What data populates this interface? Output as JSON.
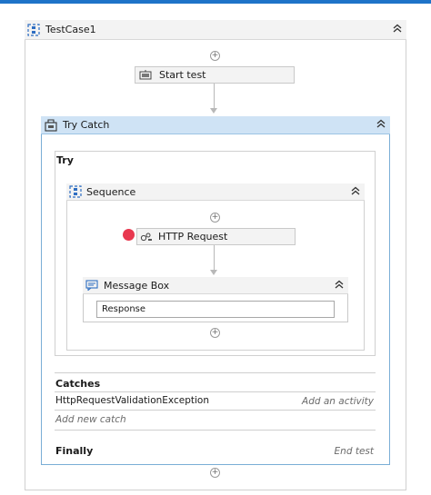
{
  "workflow": {
    "title": "TestCase1",
    "start_test": "Start test",
    "try_catch": {
      "title": "Try Catch",
      "try_label": "Try",
      "sequence": {
        "title": "Sequence",
        "http_request": "HTTP Request",
        "message_box": {
          "title": "Message Box",
          "input_value": "Response"
        }
      },
      "catches_label": "Catches",
      "catch_exception": "HttpRequestValidationException",
      "add_activity": "Add an activity",
      "add_new_catch": "Add new catch",
      "finally_label": "Finally",
      "end_test": "End test"
    }
  },
  "colors": {
    "accent_bar": "#1e73c8",
    "try_catch_header": "#cfe3f5",
    "breakpoint": "#e8384f"
  },
  "icons": {
    "collapse": "double-chevron-up-icon",
    "add": "plus-circle-icon",
    "sequence": "sequence-icon",
    "trycatch": "try-catch-icon",
    "http": "http-request-icon",
    "message": "message-box-icon",
    "start": "start-test-icon"
  }
}
